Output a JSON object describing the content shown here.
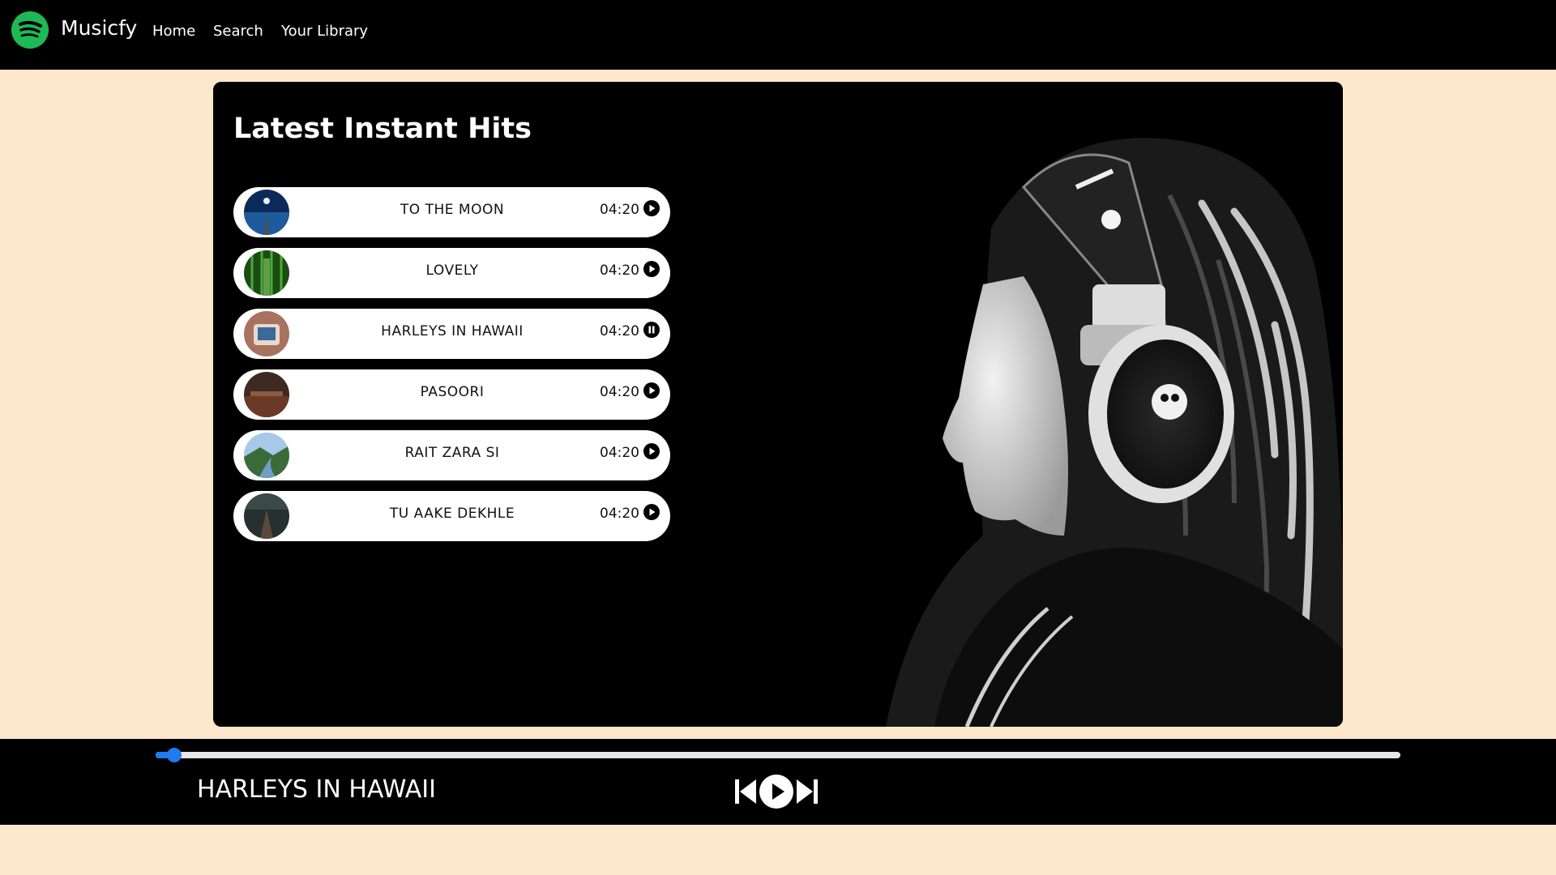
{
  "navbar": {
    "brand": "Musicfy",
    "links": [
      {
        "label": "Home"
      },
      {
        "label": "Search"
      },
      {
        "label": "Your Library"
      }
    ],
    "logo_icon": "spotify-logo-icon",
    "logo_color": "#1db954"
  },
  "main": {
    "title": "Latest Instant Hits",
    "songs": [
      {
        "name": "TO THE MOON",
        "duration": "04:20",
        "state": "play"
      },
      {
        "name": "LOVELY",
        "duration": "04:20",
        "state": "play"
      },
      {
        "name": "HARLEYS IN HAWAII",
        "duration": "04:20",
        "state": "pause"
      },
      {
        "name": "PASOORI",
        "duration": "04:20",
        "state": "play"
      },
      {
        "name": "RAIT ZARA SI",
        "duration": "04:20",
        "state": "play"
      },
      {
        "name": "TU AAKE DEKHLE",
        "duration": "04:20",
        "state": "play"
      }
    ]
  },
  "player": {
    "now_playing": "HARLEYS IN HAWAII",
    "progress_percent": 1.5,
    "accent_color": "#1e7bf0",
    "controls": [
      "previous-icon",
      "play-icon",
      "next-icon"
    ]
  }
}
